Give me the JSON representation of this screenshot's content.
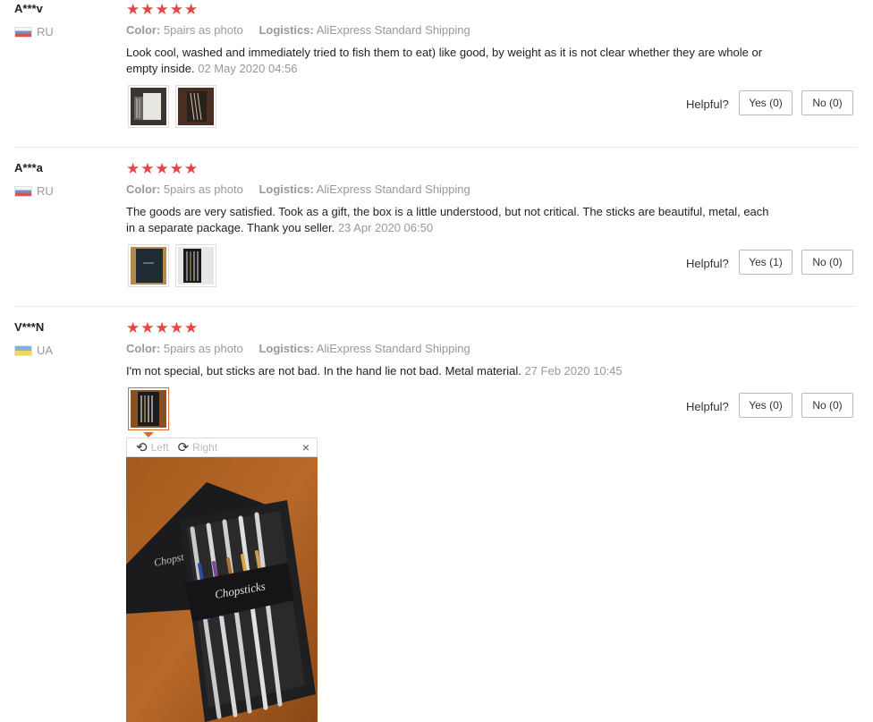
{
  "labels": {
    "color_label": "Color:",
    "logistics_label": "Logistics:",
    "helpful_label": "Helpful?"
  },
  "reviews": [
    {
      "user": "A***v",
      "country": "RU",
      "stars": 5,
      "color": "5pairs as photo",
      "logistics": "AliExpress Standard Shipping",
      "text": "Look cool, washed and immediately tried to fish them to eat) like good, by weight as it is not clear whether they are whole or empty inside.",
      "date": "02 May 2020 04:56",
      "yes": "Yes (0)",
      "no": "No (0)"
    },
    {
      "user": "A***a",
      "country": "RU",
      "stars": 5,
      "color": "5pairs as photo",
      "logistics": "AliExpress Standard Shipping",
      "text": "The goods are very satisfied. Took as a gift, the box is a little understood, but not critical. The sticks are beautiful, metal, each in a separate package. Thank you seller.",
      "date": "23 Apr 2020 06:50",
      "yes": "Yes (1)",
      "no": "No (0)"
    },
    {
      "user": "V***N",
      "country": "UA",
      "stars": 5,
      "color": "5pairs as photo",
      "logistics": "AliExpress Standard Shipping",
      "text": "I'm not special, but sticks are not bad. In the hand lie not bad. Metal material.",
      "date": "27 Feb 2020 10:45",
      "yes": "Yes (0)",
      "no": "No (0)"
    }
  ],
  "viewer": {
    "rotate_left": "Left",
    "rotate_right": "Right",
    "close": "×",
    "photo_box_text": "Chopsticks",
    "photo_lid_text": "Chopsti"
  },
  "colors": {
    "star": "#e64545",
    "active_thumb_border": "#e06a2b"
  },
  "icons": [
    "rotate-left-icon",
    "rotate-right-icon",
    "close-icon",
    "star-icon",
    "flag-icon"
  ]
}
